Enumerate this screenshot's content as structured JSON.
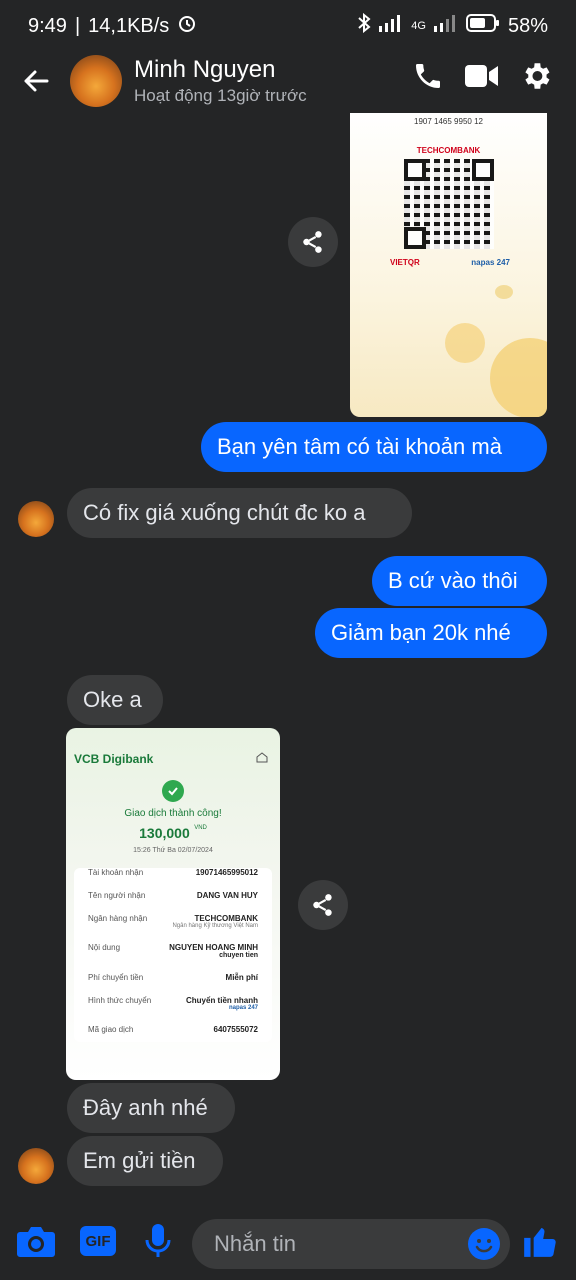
{
  "status": {
    "time": "9:49",
    "speed": "14,1KB/s",
    "network": "4G",
    "battery": "58%"
  },
  "header": {
    "name": "Minh Nguyen",
    "subtitle": "Hoạt động 13giờ trước"
  },
  "messages": {
    "m1": "Bạn yên tâm có tài khoản mà",
    "m2": "Có fix giá xuống chút đc ko a",
    "m3": "B cứ vào thôi",
    "m4": "Giảm bạn 20k nhé",
    "m5": "Oke a",
    "m6": "Đây anh nhé",
    "m7": "Em gửi tiền"
  },
  "qr_image": {
    "account": "1907 1465 9950 12",
    "bank": "TECHCOMBANK",
    "brand1": "VIETQR",
    "brand2": "napas 247"
  },
  "receipt": {
    "app": "VCB Digibank",
    "success": "Giao dịch thành công!",
    "amount": "130,000",
    "currency": "VND",
    "datetime": "15:26 Thứ Ba 02/07/2024",
    "rows": [
      {
        "label": "Tài khoản nhận",
        "value": "19071465995012",
        "sub": ""
      },
      {
        "label": "Tên người nhận",
        "value": "DANG VAN HUY",
        "sub": ""
      },
      {
        "label": "Ngân hàng nhận",
        "value": "TECHCOMBANK",
        "sub": "Ngân hàng Kỹ thương Việt Nam"
      },
      {
        "label": "Nội dung",
        "value": "NGUYEN HOANG MINH",
        "sub": "chuyen tien"
      },
      {
        "label": "Phí chuyển tiền",
        "value": "Miễn phí",
        "sub": ""
      },
      {
        "label": "Hình thức chuyển",
        "value": "Chuyển tiền nhanh",
        "sub": "napas 247"
      },
      {
        "label": "Mã giao dịch",
        "value": "6407555072",
        "sub": ""
      }
    ]
  },
  "composer": {
    "placeholder": "Nhắn tin",
    "gif": "GIF"
  },
  "colors": {
    "accent": "#0866ff",
    "background": "#242526",
    "incoming": "#3a3b3c"
  }
}
